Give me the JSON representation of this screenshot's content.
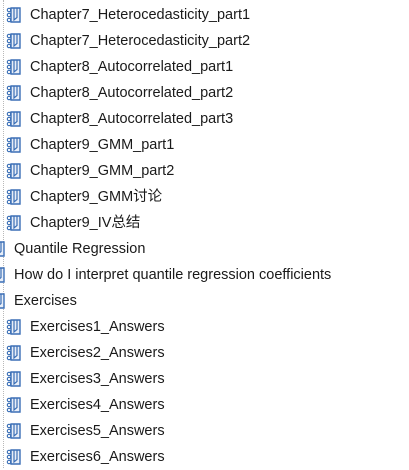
{
  "tree": {
    "items": [
      {
        "label": "Chapter7_Heterocedasticity_part1",
        "icon": "notebook-page-icon",
        "level": "child"
      },
      {
        "label": "Chapter7_Heterocedasticity_part2",
        "icon": "notebook-page-icon",
        "level": "child"
      },
      {
        "label": "Chapter8_Autocorrelated_part1",
        "icon": "notebook-page-icon",
        "level": "child"
      },
      {
        "label": "Chapter8_Autocorrelated_part2",
        "icon": "notebook-page-icon",
        "level": "child"
      },
      {
        "label": "Chapter8_Autocorrelated_part3",
        "icon": "notebook-page-icon",
        "level": "child"
      },
      {
        "label": "Chapter9_GMM_part1",
        "icon": "notebook-page-icon",
        "level": "child"
      },
      {
        "label": "Chapter9_GMM_part2",
        "icon": "notebook-page-icon",
        "level": "child"
      },
      {
        "label": "Chapter9_GMM讨论",
        "icon": "notebook-page-icon",
        "level": "child"
      },
      {
        "label": "Chapter9_IV总结",
        "icon": "notebook-page-icon",
        "level": "child"
      },
      {
        "label": "Quantile Regression",
        "icon": "notebook-page-icon",
        "level": "top"
      },
      {
        "label": "How do I interpret quantile regression coefficients",
        "icon": "notebook-page-icon",
        "level": "top"
      },
      {
        "label": "Exercises",
        "icon": "notebook-page-icon",
        "level": "top"
      },
      {
        "label": "Exercises1_Answers",
        "icon": "notebook-page-icon",
        "level": "child"
      },
      {
        "label": "Exercises2_Answers",
        "icon": "notebook-page-icon",
        "level": "child"
      },
      {
        "label": "Exercises3_Answers",
        "icon": "notebook-page-icon",
        "level": "child"
      },
      {
        "label": "Exercises4_Answers",
        "icon": "notebook-page-icon",
        "level": "child"
      },
      {
        "label": "Exercises5_Answers",
        "icon": "notebook-page-icon",
        "level": "child"
      },
      {
        "label": "Exercises6_Answers",
        "icon": "notebook-page-icon",
        "level": "child"
      }
    ]
  },
  "colors": {
    "text": "#1a1a1a",
    "icon_blue": "#3b6fb6",
    "icon_fill": "#e8eef8",
    "guide": "#b9b9b9"
  }
}
